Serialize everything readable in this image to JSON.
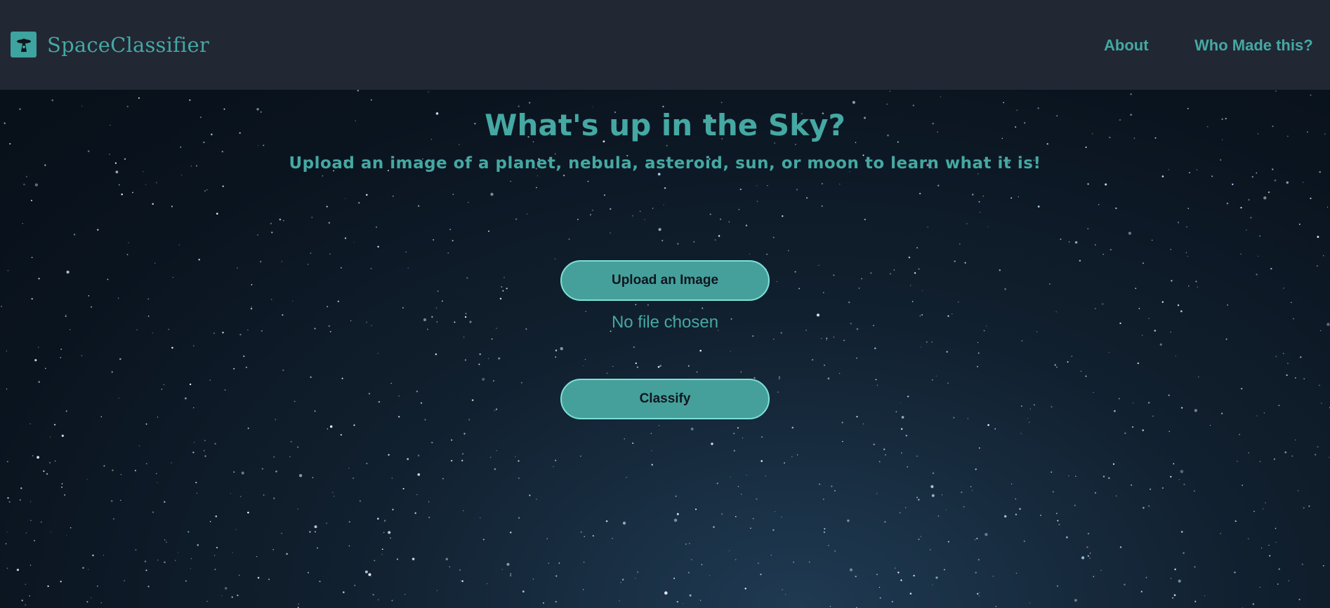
{
  "navbar": {
    "brand": {
      "icon": "ufo-icon",
      "name": "SpaceClassifier"
    },
    "links": [
      {
        "label": "About"
      },
      {
        "label": "Who Made this?"
      }
    ]
  },
  "main": {
    "title": "What's up in the Sky?",
    "subtitle": "Upload an image of a planet, nebula, asteroid, sun, or moon to learn what it is!",
    "upload_button": "Upload an Image",
    "file_status": "No file chosen",
    "classify_button": "Classify"
  },
  "colors": {
    "accent": "#45a8a3",
    "navbar_bg": "#212733",
    "button_bg": "#45a09c",
    "button_border": "#7de0d8"
  }
}
